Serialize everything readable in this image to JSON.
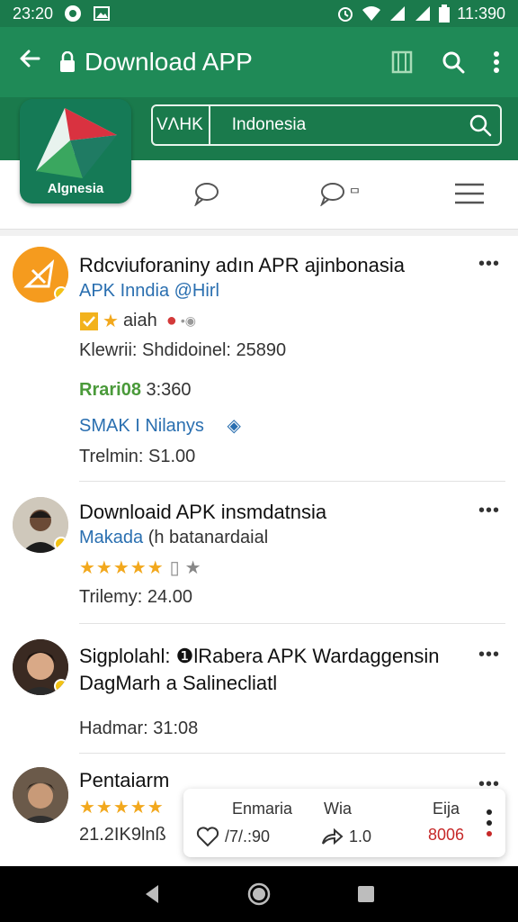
{
  "status_bar": {
    "time": "23:20",
    "battery_time": "11:390"
  },
  "app_bar": {
    "title": "Download APP"
  },
  "search": {
    "prefix": "VΛHK",
    "value": "Indonesia"
  },
  "logo": {
    "label": "Algnesia"
  },
  "tabs": [
    {
      "label": ""
    },
    {
      "label": "ᄆ"
    },
    {
      "label": ""
    }
  ],
  "items": [
    {
      "title": "Rdcviuforaniny adın APR ajinbonasia",
      "subtitle": "APK Inndia @Hirl",
      "tag": "aiah",
      "meta1": "Klewrii: Shdidoinel: 25890",
      "rating_label": "Rrari08",
      "rating_value": "3:360",
      "link": "SMAK I Nilanys",
      "footer": "Trelmin: S1.00"
    },
    {
      "title": "Downloaid APK insmdatnsia",
      "subtitle": "Makada",
      "subtitle2": "(h batanardaial",
      "stars": "★★★★★",
      "footer": "Trilemy: 24.00"
    },
    {
      "title": "Sigplolahl: ❶lRabera APK Wardaggensin",
      "subtitle": "DagMarh a Salinecliatl",
      "footer": "Hadmar: 31:08"
    },
    {
      "title": "Pentaiarm",
      "stars": "★★★★★",
      "footer": "21.2IK9lnß"
    }
  ],
  "actions": [
    {
      "label": "Enmaria",
      "value": "/7/.:90"
    },
    {
      "label": "Wia",
      "value": "1.0"
    },
    {
      "label": "Eija",
      "value": "8006"
    }
  ],
  "colors": {
    "primary": "#1f8a57",
    "primary_dark": "#1b7a4c",
    "accent": "#f2a81d",
    "link_blue": "#2a6fb0",
    "red": "#c62828"
  },
  "icons": [
    "back-arrow-icon",
    "lock-icon",
    "bookmark-icon",
    "search-icon",
    "more-vert-icon",
    "chat-bubble-icon",
    "menu-icon",
    "heart-icon",
    "share-icon",
    "nav-back-icon",
    "nav-home-icon",
    "nav-recents-icon"
  ]
}
